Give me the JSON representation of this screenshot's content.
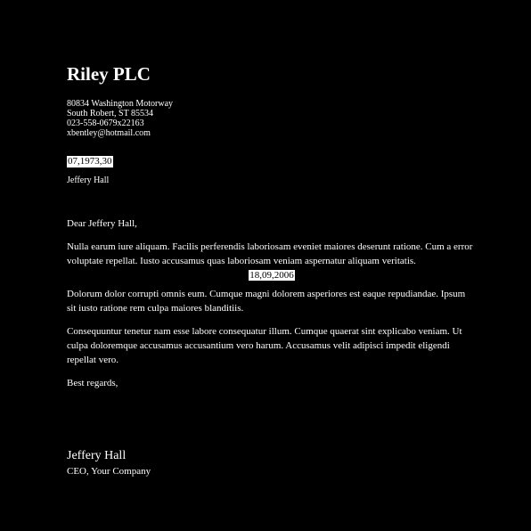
{
  "letter": {
    "company_name": "Riley PLC",
    "address": {
      "street": "80834 Washington Motorway",
      "city_line": "South Robert, ST 85534",
      "phone": "023-558-0679x22163",
      "email": "xbentley@hotmail.com"
    },
    "date_top": "07,1973,30",
    "recipient": "Jeffery Hall",
    "greeting": "Dear Jeffery Hall,",
    "paragraph_1": "Nulla earum iure aliquam. Facilis perferendis laboriosam eveniet maiores deserunt ratione. Cum a error voluptate repellat. Iusto accusamus quas laboriosam veniam aspernatur aliquam veritatis.",
    "date_mid": "18,09,2006",
    "paragraph_2": "Dolorum dolor corrupti omnis eum. Cumque magni dolorem asperiores est eaque repudiandae. Ipsum sit iusto ratione rem culpa maiores blanditiis.",
    "paragraph_3": "Consequuntur tenetur nam esse labore consequatur illum. Cumque quaerat sint explicabo veniam. Ut culpa doloremque accusamus accusantium vero harum. Accusamus velit adipisci impedit eligendi repellat vero.",
    "closing": "Best regards,",
    "signer_name": "Jeffery Hall",
    "signer_title": "CEO, Your Company"
  },
  "colors": {
    "background": "#000000",
    "text": "#ffffff",
    "highlight_bg": "#ffffff",
    "highlight_text": "#000000"
  }
}
